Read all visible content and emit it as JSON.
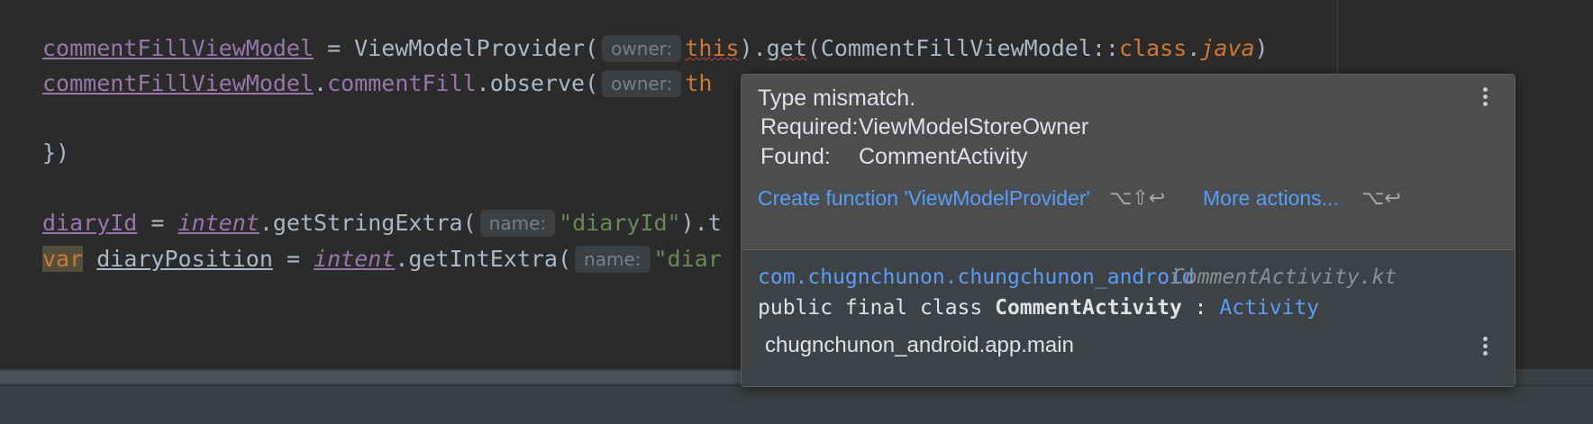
{
  "code": {
    "line1": {
      "prop": "commentFillViewModel",
      "assign": " = ViewModelProvider(",
      "hint": "owner:",
      "this_kw": "this",
      "mid": ").",
      "get": "get",
      "rest1": "(CommentFillViewModel::",
      "class_kw": "class",
      "dot": ".",
      "java": "java",
      "close": ")"
    },
    "line2": {
      "prop": "commentFillViewModel",
      "dot": ".",
      "prop2": "commentFill",
      "call": ".observe(",
      "hint": "owner:",
      "this_partial": "th"
    },
    "line3": {
      "text": "})"
    },
    "line4": {
      "prop": "diaryId",
      "assign": " = ",
      "intent": "intent",
      "call": ".getStringExtra(",
      "hint": "name:",
      "str": "\"diaryId\"",
      "tail": ").t"
    },
    "line5": {
      "var_kw": "var",
      "name": "diaryPosition",
      "assign": " = ",
      "intent": "intent",
      "call": ".getIntExtra(",
      "hint": "name:",
      "str": "\"diar"
    }
  },
  "popup": {
    "title": "Type mismatch.",
    "required_label": "Required:",
    "required_value": "ViewModelStoreOwner",
    "found_label": "Found:",
    "found_value": "CommentActivity",
    "action_create": "Create function 'ViewModelProvider'",
    "action_create_shortcut": "⌥⇧↩",
    "action_more": "More actions...",
    "action_more_shortcut": "⌥↩",
    "package": "com.chugnchunon.chungchunon_android",
    "file": "CommentActivity.kt",
    "decl_prefix": "public final class ",
    "decl_class": "CommentActivity",
    "decl_colon": " : ",
    "decl_super": "Activity",
    "module": "chugnchunon_android.app.main"
  },
  "colors": {
    "editor_bg": "#2b2b2b",
    "property": "#9876aa",
    "keyword": "#cc7832",
    "string": "#6a8759",
    "link": "#589df6",
    "popup_bg": "#4b4d4f"
  },
  "icons": [
    "kebab-menu-icon",
    "kebab-menu-icon"
  ]
}
